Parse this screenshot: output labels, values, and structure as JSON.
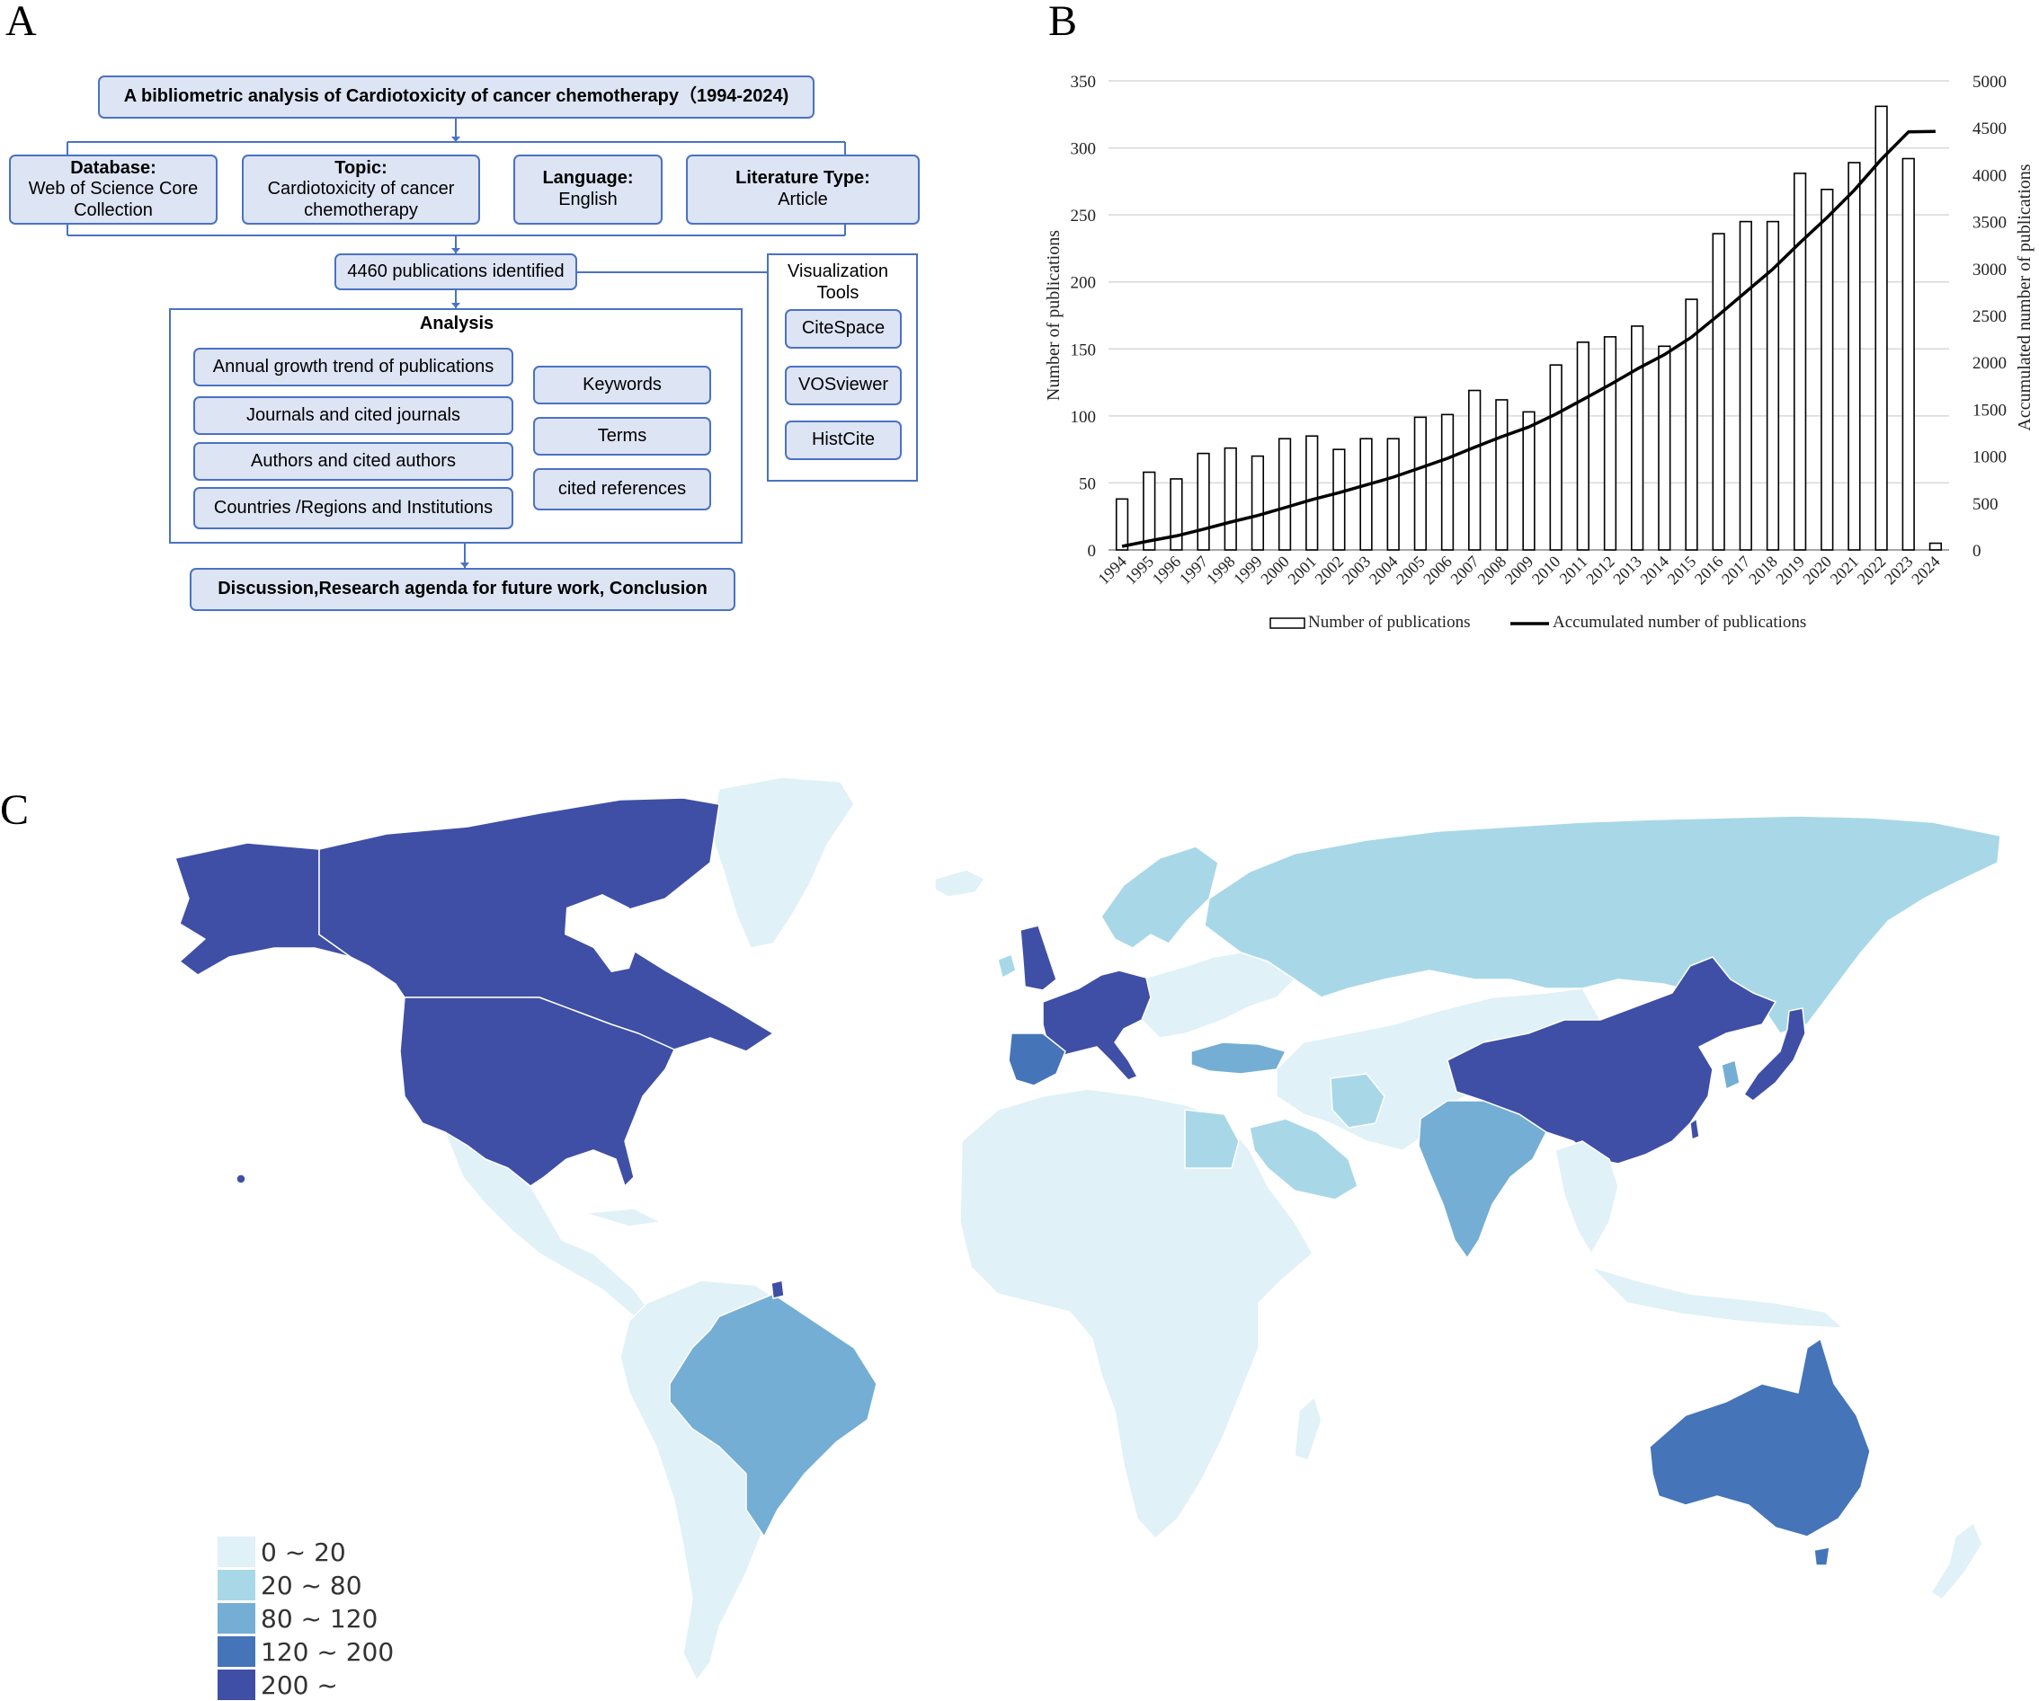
{
  "panel_labels": {
    "a": "A",
    "b": "B",
    "c": "C"
  },
  "flow": {
    "title": "A bibliometric analysis of Cardiotoxicity of cancer chemotherapy（1994-2024)",
    "database_label": "Database:",
    "database_value": "Web of Science Core Collection",
    "topic_label": "Topic:",
    "topic_value": "Cardiotoxicity of cancer chemotherapy",
    "language_label": "Language:",
    "language_value": "English",
    "lit_type_label": "Literature Type:",
    "lit_type_value": "Article",
    "identified": "4460 publications identified",
    "analysis_title": "Analysis",
    "analysis_items": [
      "Annual growth trend of publications",
      "Journals and cited journals",
      "Authors and cited authors",
      "Countries /Regions and Institutions"
    ],
    "analysis_right": [
      "Keywords",
      "Terms",
      "cited references"
    ],
    "viz_title": "Visualization Tools",
    "viz_tools": [
      "CiteSpace",
      "VOSviewer",
      "HistCite"
    ],
    "conclusion": "Discussion,Research agenda for future work, Conclusion"
  },
  "chart_data": {
    "type": "bar",
    "categories": [
      "1994",
      "1995",
      "1996",
      "1997",
      "1998",
      "1999",
      "2000",
      "2001",
      "2002",
      "2003",
      "2004",
      "2005",
      "2006",
      "2007",
      "2008",
      "2009",
      "2010",
      "2011",
      "2012",
      "2013",
      "2014",
      "2015",
      "2016",
      "2017",
      "2018",
      "2019",
      "2020",
      "2021",
      "2022",
      "2023",
      "2024"
    ],
    "series": [
      {
        "name": "Number of publications",
        "type": "bar",
        "values": [
          38,
          58,
          53,
          72,
          76,
          70,
          83,
          85,
          75,
          83,
          83,
          99,
          101,
          119,
          112,
          103,
          138,
          155,
          159,
          167,
          152,
          187,
          236,
          245,
          245,
          281,
          269,
          289,
          331,
          292,
          5
        ]
      },
      {
        "name": "Accumulated number of publications",
        "type": "line",
        "axis": "right",
        "values": [
          38,
          96,
          149,
          221,
          297,
          367,
          450,
          535,
          610,
          693,
          776,
          875,
          976,
          1095,
          1207,
          1310,
          1448,
          1603,
          1762,
          1929,
          2081,
          2268,
          2504,
          2749,
          2994,
          3275,
          3544,
          3833,
          4164,
          4456,
          4461
        ]
      }
    ],
    "ylabel": "Number of publications",
    "y2label": "Accumulated number of publications",
    "ylim": [
      0,
      350
    ],
    "y2lim": [
      0,
      5000
    ],
    "yticks": [
      "0",
      "50",
      "100",
      "150",
      "200",
      "250",
      "300",
      "350"
    ],
    "y2ticks": [
      "0",
      "500",
      "1000",
      "1500",
      "2000",
      "2500",
      "3000",
      "3500",
      "4000",
      "4500",
      "5000"
    ],
    "grid": true,
    "legend": "bottom"
  },
  "map": {
    "legend": [
      {
        "label": "0 ~ 20",
        "color": "#e0f1f7"
      },
      {
        "label": "20 ~ 80",
        "color": "#a8d8e8"
      },
      {
        "label": "80 ~ 120",
        "color": "#74aed4"
      },
      {
        "label": "120 ~ 200",
        "color": "#4574b8"
      },
      {
        "label": "200 ~",
        "color": "#3f4fa6"
      }
    ]
  }
}
